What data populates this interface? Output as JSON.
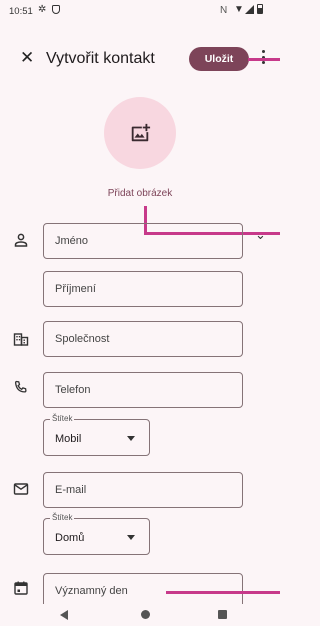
{
  "status_bar": {
    "time": "10:51",
    "nfc": "N"
  },
  "app_bar": {
    "title": "Vytvořit kontakt",
    "save_label": "Uložit"
  },
  "photo": {
    "add_label": "Přidat obrázek"
  },
  "form": {
    "first_name_placeholder": "Jméno",
    "last_name_placeholder": "Příjmení",
    "company_placeholder": "Společnost",
    "phone_placeholder": "Telefon",
    "phone_label_caption": "Štítek",
    "phone_label_value": "Mobil",
    "email_placeholder": "E-mail",
    "email_label_caption": "Štítek",
    "email_label_value": "Domů",
    "event_placeholder": "Významný den"
  },
  "colors": {
    "accent": "#7d4459",
    "callout": "#c7398a",
    "background": "#fcf5f7"
  }
}
